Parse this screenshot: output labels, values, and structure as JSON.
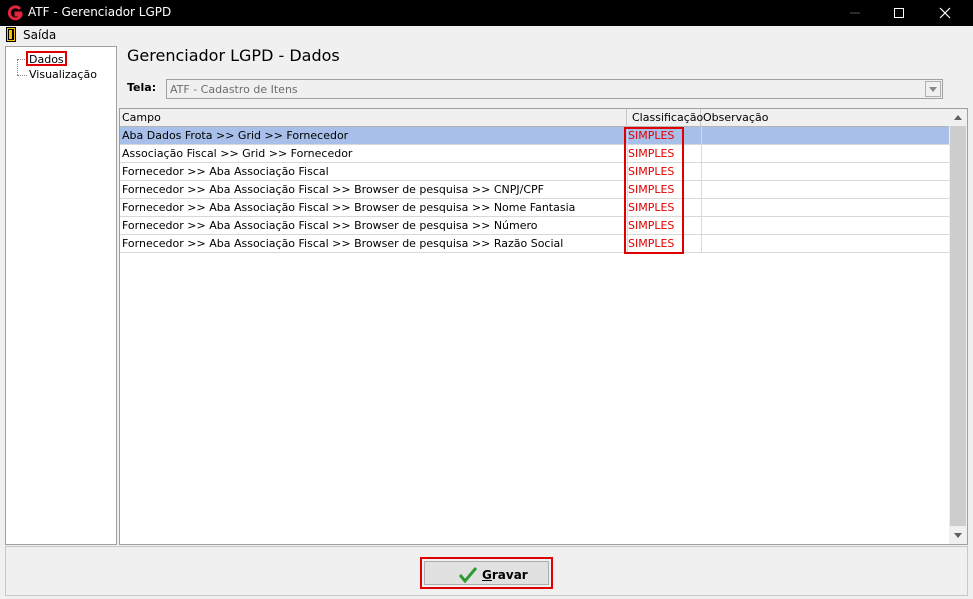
{
  "window": {
    "title": "ATF - Gerenciador LGPD",
    "app_icon": "atf-logo-icon",
    "controls": [
      "minimize-icon",
      "maximize-icon",
      "close-icon"
    ]
  },
  "menu": {
    "exit_label": "Saída",
    "exit_icon": "door-exit-icon"
  },
  "nav_tree": {
    "items": [
      {
        "label": "Dados",
        "selected": true
      },
      {
        "label": "Visualização",
        "selected": false
      }
    ]
  },
  "main": {
    "title": "Gerenciador LGPD - Dados",
    "tela_label": "Tela:",
    "tela_value": "ATF - Cadastro de Itens"
  },
  "grid": {
    "columns": [
      "Campo",
      "Classificação",
      "Observação"
    ],
    "rows": [
      {
        "campo": "Aba Dados Frota >> Grid >> Fornecedor",
        "classificacao": "SIMPLES",
        "observacao": ""
      },
      {
        "campo": "Associação Fiscal >> Grid >> Fornecedor",
        "classificacao": "SIMPLES",
        "observacao": ""
      },
      {
        "campo": "Fornecedor >> Aba Associação Fiscal",
        "classificacao": "SIMPLES",
        "observacao": ""
      },
      {
        "campo": "Fornecedor >> Aba Associação Fiscal >> Browser de pesquisa >> CNPJ/CPF",
        "classificacao": "SIMPLES",
        "observacao": ""
      },
      {
        "campo": "Fornecedor >> Aba Associação Fiscal >> Browser de pesquisa >> Nome Fantasia",
        "classificacao": "SIMPLES",
        "observacao": ""
      },
      {
        "campo": "Fornecedor >> Aba Associação Fiscal >> Browser de pesquisa >> Número",
        "classificacao": "SIMPLES",
        "observacao": ""
      },
      {
        "campo": "Fornecedor >> Aba Associação Fiscal >> Browser de pesquisa >> Razão Social",
        "classificacao": "SIMPLES",
        "observacao": ""
      }
    ]
  },
  "footer": {
    "save_label_first": "G",
    "save_label_rest": "ravar",
    "save_icon": "checkmark-icon"
  },
  "colors": {
    "highlight": "#e00000",
    "selected_row": "#a7bfe9",
    "classification_text": "#e00000",
    "check_green": "#2e9a2e"
  }
}
